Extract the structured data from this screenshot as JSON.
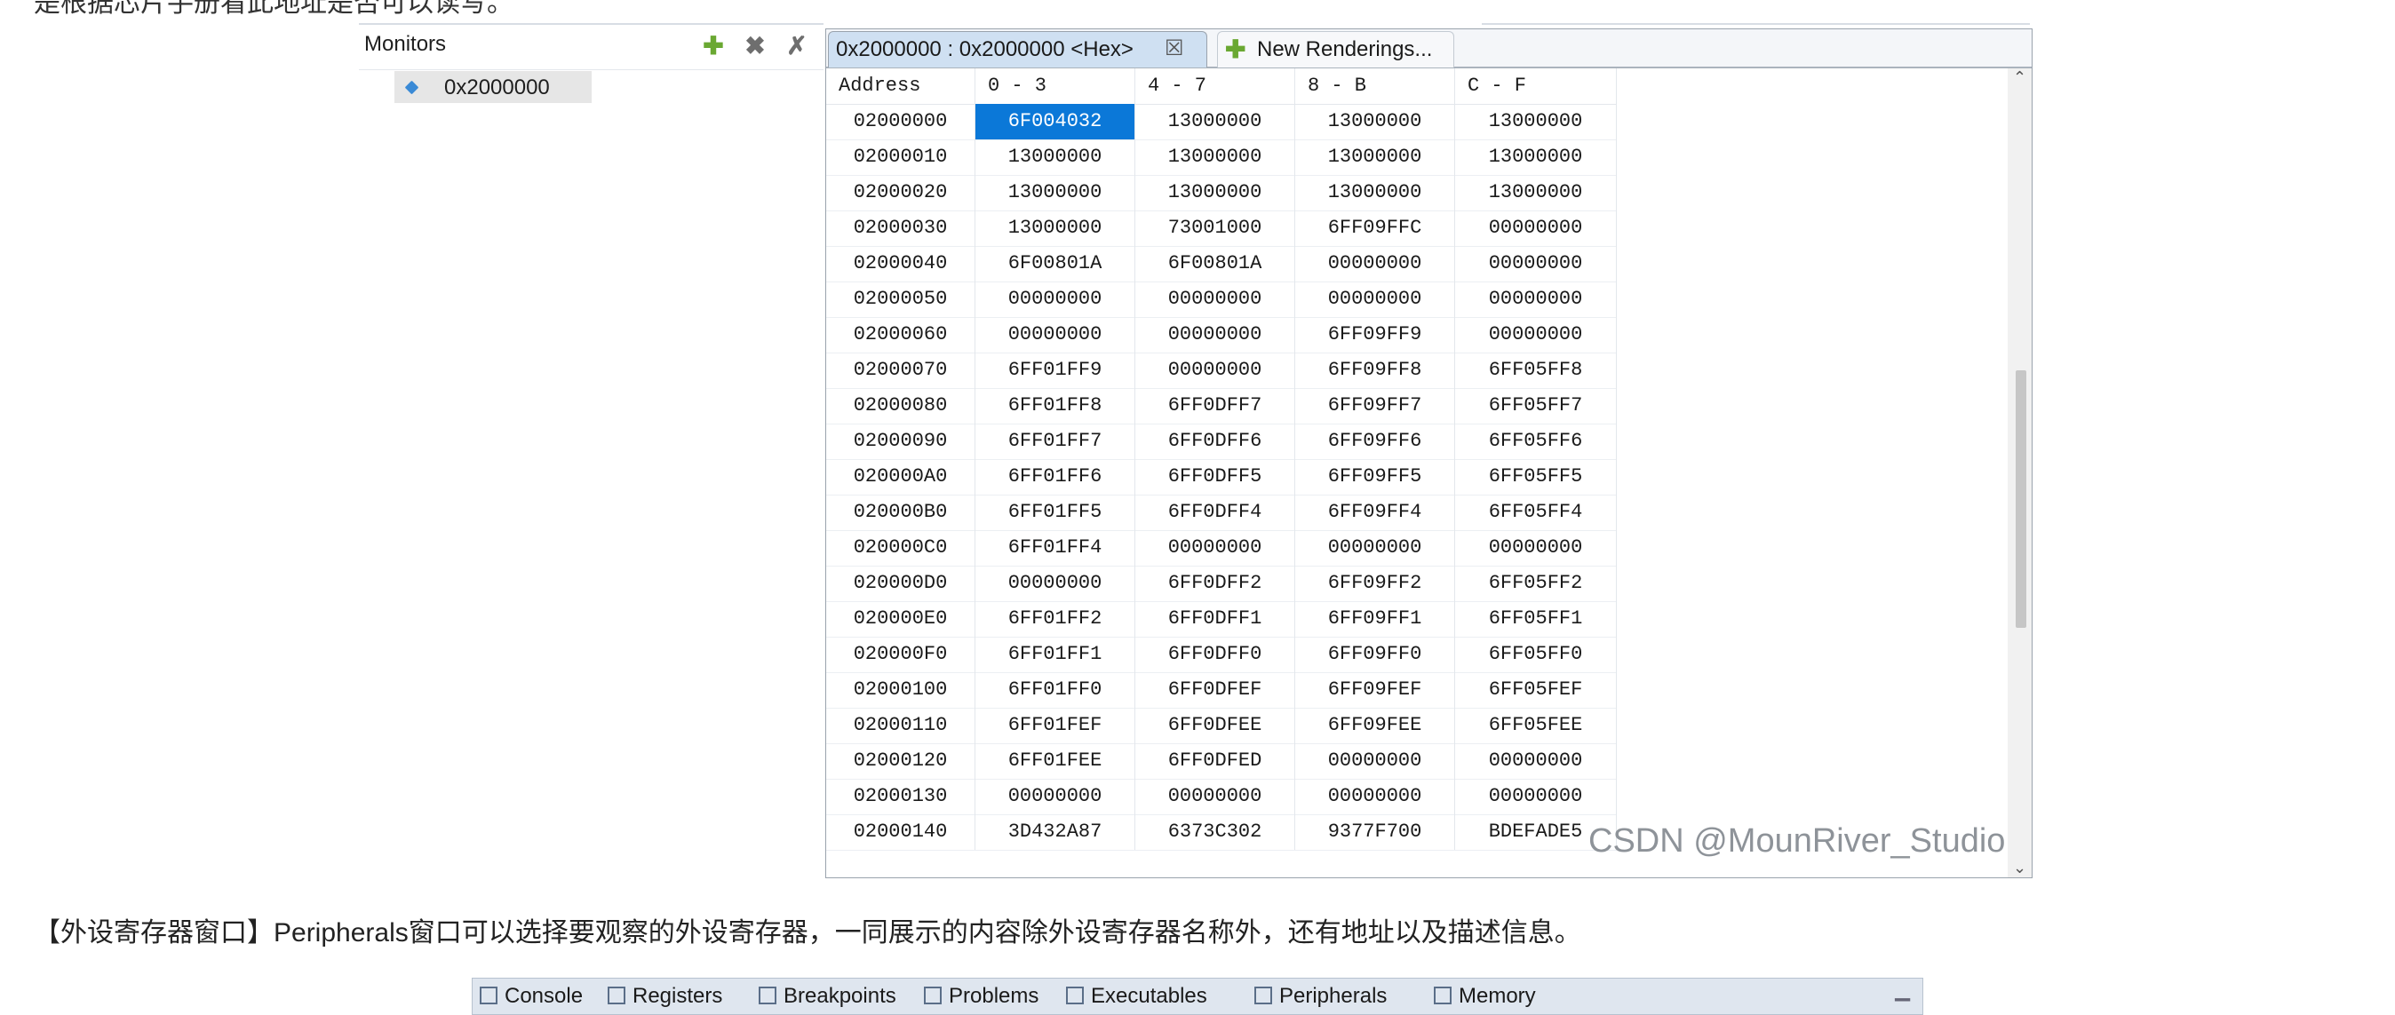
{
  "top_text": "是根据芯片手册看此地址是否可以读写。",
  "monitors": {
    "title": "Monitors",
    "tools": {
      "add_icon": "add-monitor-icon",
      "remove_icon": "remove-monitor-icon",
      "remove_all_icon": "remove-all-monitors-icon"
    },
    "items": [
      "0x2000000"
    ]
  },
  "memory_view": {
    "active_tab": {
      "label": "0x2000000 : 0x2000000 <Hex>",
      "close": "☒"
    },
    "new_tab": {
      "label": "New Renderings..."
    },
    "headers": [
      "Address",
      "0 - 3",
      "4 - 7",
      "8 - B",
      "C - F"
    ],
    "rows": [
      [
        "02000000",
        "6F004032",
        "13000000",
        "13000000",
        "13000000"
      ],
      [
        "02000010",
        "13000000",
        "13000000",
        "13000000",
        "13000000"
      ],
      [
        "02000020",
        "13000000",
        "13000000",
        "13000000",
        "13000000"
      ],
      [
        "02000030",
        "13000000",
        "73001000",
        "6FF09FFC",
        "00000000"
      ],
      [
        "02000040",
        "6F00801A",
        "6F00801A",
        "00000000",
        "00000000"
      ],
      [
        "02000050",
        "00000000",
        "00000000",
        "00000000",
        "00000000"
      ],
      [
        "02000060",
        "00000000",
        "00000000",
        "6FF09FF9",
        "00000000"
      ],
      [
        "02000070",
        "6FF01FF9",
        "00000000",
        "6FF09FF8",
        "6FF05FF8"
      ],
      [
        "02000080",
        "6FF01FF8",
        "6FF0DFF7",
        "6FF09FF7",
        "6FF05FF7"
      ],
      [
        "02000090",
        "6FF01FF7",
        "6FF0DFF6",
        "6FF09FF6",
        "6FF05FF6"
      ],
      [
        "020000A0",
        "6FF01FF6",
        "6FF0DFF5",
        "6FF09FF5",
        "6FF05FF5"
      ],
      [
        "020000B0",
        "6FF01FF5",
        "6FF0DFF4",
        "6FF09FF4",
        "6FF05FF4"
      ],
      [
        "020000C0",
        "6FF01FF4",
        "00000000",
        "00000000",
        "00000000"
      ],
      [
        "020000D0",
        "00000000",
        "6FF0DFF2",
        "6FF09FF2",
        "6FF05FF2"
      ],
      [
        "020000E0",
        "6FF01FF2",
        "6FF0DFF1",
        "6FF09FF1",
        "6FF05FF1"
      ],
      [
        "020000F0",
        "6FF01FF1",
        "6FF0DFF0",
        "6FF09FF0",
        "6FF05FF0"
      ],
      [
        "02000100",
        "6FF01FF0",
        "6FF0DFEF",
        "6FF09FEF",
        "6FF05FEF"
      ],
      [
        "02000110",
        "6FF01FEF",
        "6FF0DFEE",
        "6FF09FEE",
        "6FF05FEE"
      ],
      [
        "02000120",
        "6FF01FEE",
        "6FF0DFED",
        "00000000",
        "00000000"
      ],
      [
        "02000130",
        "00000000",
        "00000000",
        "00000000",
        "00000000"
      ],
      [
        "02000140",
        "3D432A87",
        "6373C302",
        "9377F700",
        "BDEFADE5"
      ]
    ],
    "selected": {
      "row": 0,
      "col": 1
    }
  },
  "watermark": "CSDN @MounRiver_Studio",
  "description": "【外设寄存器窗口】Peripherals窗口可以选择要观察的外设寄存器，一同展示的内容除外设寄存器名称外，还有地址以及描述信息。",
  "bottom_tabs": [
    "Console",
    "Registers",
    "Breakpoints",
    "Problems",
    "Executables",
    "Peripherals",
    "Memory"
  ],
  "colors": {
    "selection": "#0b78d8",
    "tab_active": "#cfe0f2",
    "add_green": "#6aa832"
  }
}
